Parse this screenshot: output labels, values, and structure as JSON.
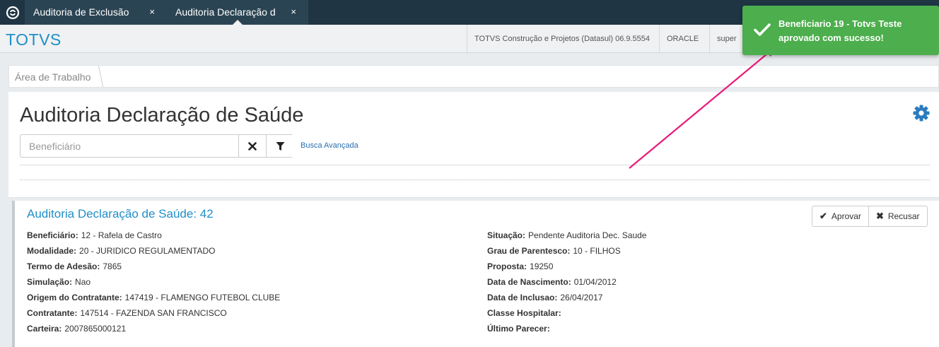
{
  "tabs": [
    {
      "label": "Auditoria de Exclusão",
      "close": "×"
    },
    {
      "label": "Auditoria Declaração de Saúde",
      "close": "×"
    }
  ],
  "header": {
    "brand": "TOTVS",
    "company": "TOTVS Construção e Projetos (Datasul) 06.9.5554",
    "database": "ORACLE",
    "user": "super"
  },
  "breadcrumb": {
    "item": "Área de Trabalho"
  },
  "page": {
    "title": "Auditoria Declaração de Saúde",
    "search_placeholder": "Beneficiário",
    "advanced_search": "Busca Avançada"
  },
  "record": {
    "title": "Auditoria Declaração de Saúde: 42",
    "approve_label": "Aprovar",
    "reject_label": "Recusar",
    "left_fields": [
      {
        "label": "Beneficiário:",
        "value": "12 - Rafela de Castro"
      },
      {
        "label": "Modalidade:",
        "value": "20 - JURIDICO REGULAMENTADO"
      },
      {
        "label": "Termo de Adesão:",
        "value": "7865"
      },
      {
        "label": "Simulação:",
        "value": "Nao"
      },
      {
        "label": "Origem do Contratante:",
        "value": "147419 - FLAMENGO FUTEBOL CLUBE"
      },
      {
        "label": "Contratante:",
        "value": "147514 - FAZENDA SAN FRANCISCO"
      },
      {
        "label": "Carteira:",
        "value": "2007865000121"
      }
    ],
    "right_fields": [
      {
        "label": "Situação:",
        "value": "Pendente Auditoria Dec. Saude"
      },
      {
        "label": "Grau de Parentesco:",
        "value": "10 - FILHOS"
      },
      {
        "label": "Proposta:",
        "value": "19250"
      },
      {
        "label": "Data de Nascimento:",
        "value": "01/04/2012"
      },
      {
        "label": "Data de Inclusao:",
        "value": "26/04/2017"
      },
      {
        "label": "Classe Hospitalar:",
        "value": ""
      },
      {
        "label": "Último Parecer:",
        "value": ""
      }
    ]
  },
  "toast": {
    "line1": "Beneficiario 19 - Totvs Teste",
    "line2": "aprovado com sucesso!"
  },
  "colors": {
    "topbar": "#1f3544",
    "brand": "#1f8fc8",
    "toast": "#4cae4c",
    "annotation": "#e8197a"
  }
}
